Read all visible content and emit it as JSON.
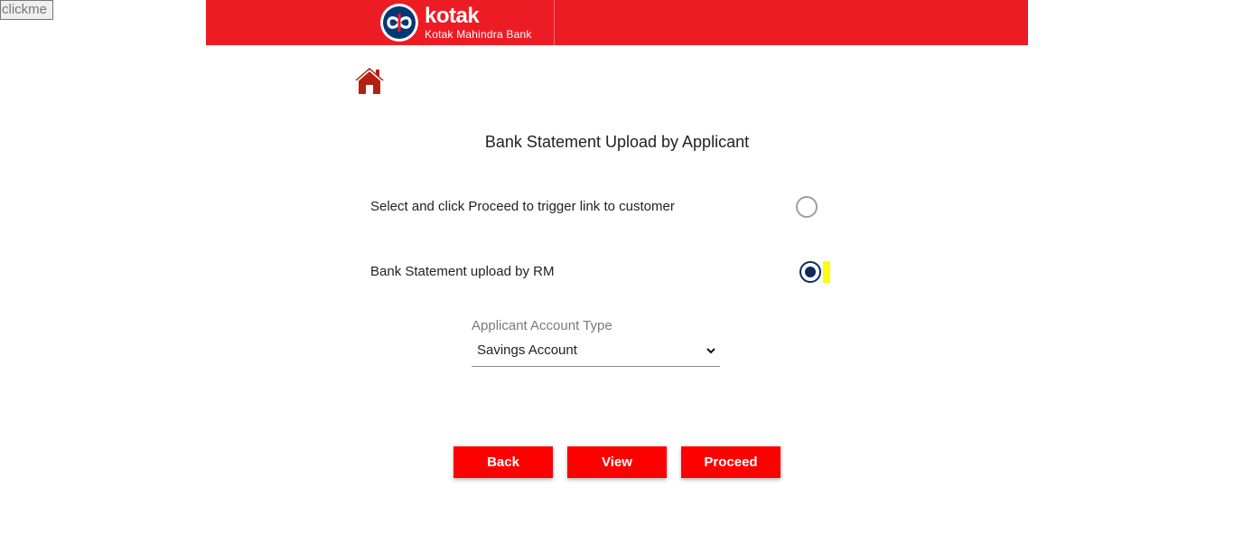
{
  "clickme_label": "clickme",
  "header": {
    "brand": "kotak",
    "subtitle": "Kotak Mahindra Bank",
    "bg_color": "#ed1c24",
    "logo_icon": "kotak-infinity-logo-icon"
  },
  "home_icon": "home-icon",
  "page": {
    "title": "Bank Statement Upload by Applicant"
  },
  "options": [
    {
      "label": "Select and click Proceed to trigger link to customer",
      "selected": false
    },
    {
      "label": "Bank Statement upload by RM",
      "selected": true
    }
  ],
  "account_type": {
    "label": "Applicant Account Type",
    "value": "Savings Account"
  },
  "buttons": {
    "back": "Back",
    "view": "View",
    "proceed": "Proceed",
    "color": "#ff0000"
  },
  "accent_color": "#0e2a5c"
}
